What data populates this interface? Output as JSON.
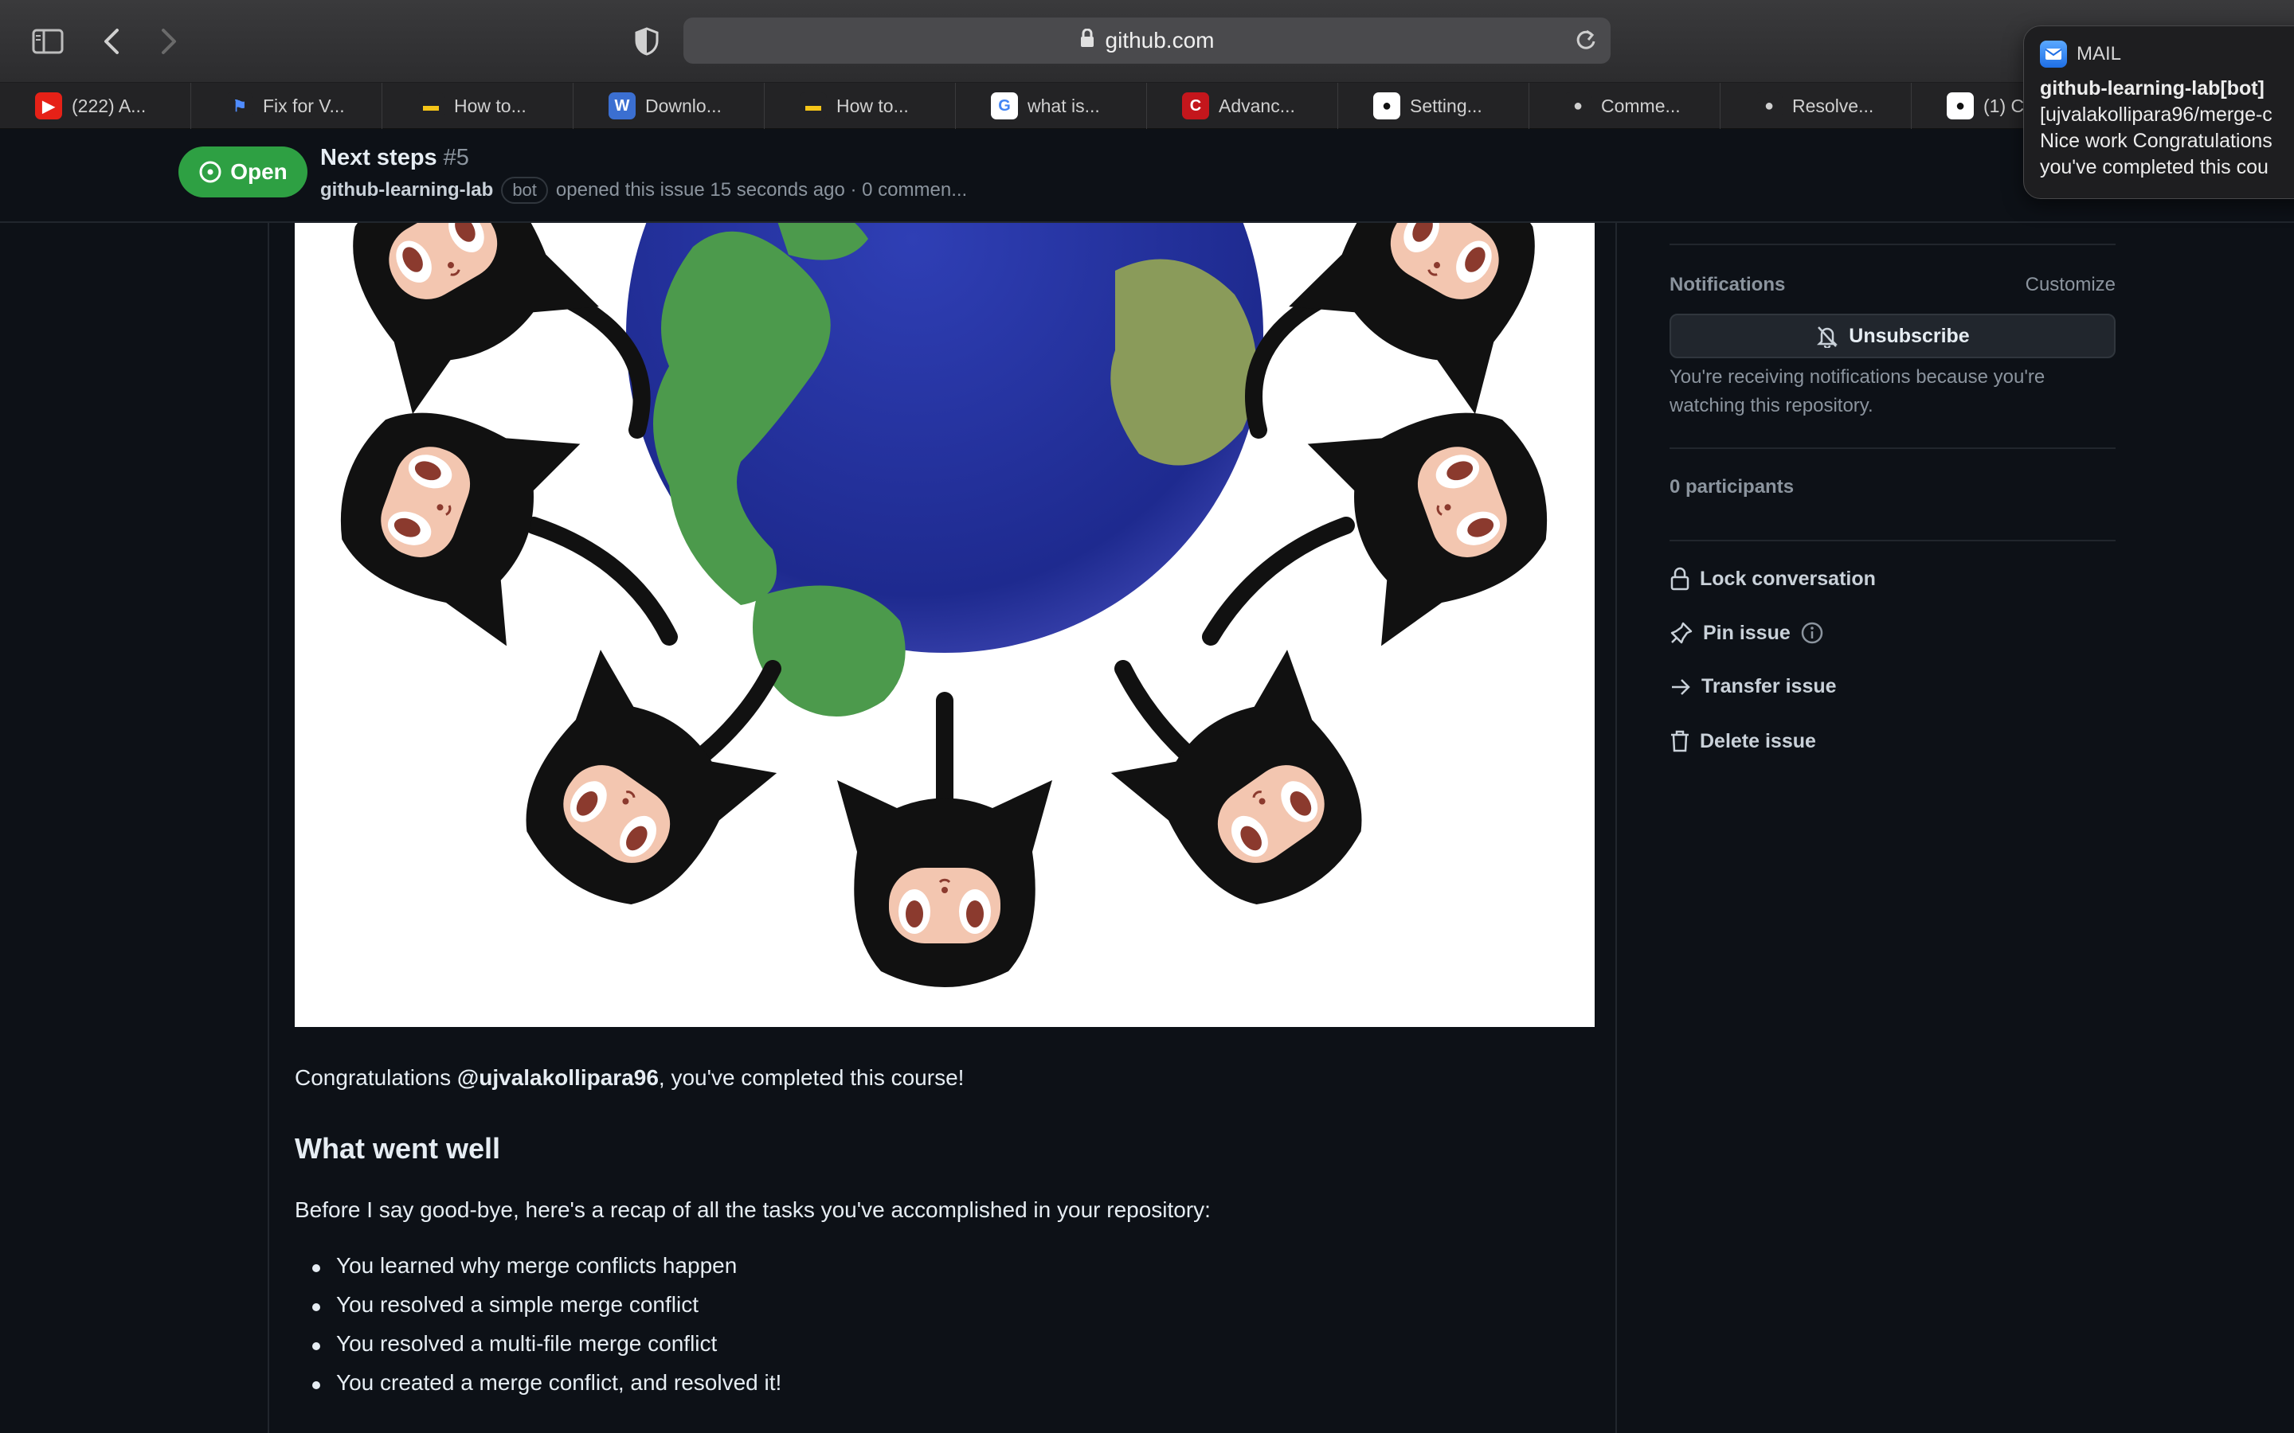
{
  "browser": {
    "url": "github.com",
    "tabs": [
      {
        "label": "(222) A...",
        "favicon": "youtube-icon",
        "fav_bg": "#e62117",
        "fav_fg": "#ffffff",
        "glyph": "▶"
      },
      {
        "label": "Fix for V...",
        "favicon": "bookmark-icon",
        "fav_bg": "#232325",
        "fav_fg": "#4f8cff",
        "glyph": "⚑"
      },
      {
        "label": "How to...",
        "favicon": "site-icon",
        "fav_bg": "#232325",
        "fav_fg": "#f5c518",
        "glyph": "▬"
      },
      {
        "label": "Downlo...",
        "favicon": "download-site-icon",
        "fav_bg": "#3b6fd1",
        "fav_fg": "#ffffff",
        "glyph": "W"
      },
      {
        "label": "How to...",
        "favicon": "site-icon",
        "fav_bg": "#232325",
        "fav_fg": "#f5c518",
        "glyph": "▬"
      },
      {
        "label": "what is...",
        "favicon": "google-icon",
        "fav_bg": "#ffffff",
        "fav_fg": "#4285f4",
        "glyph": "G"
      },
      {
        "label": "Advanc...",
        "favicon": "c-site-icon",
        "fav_bg": "#c4161c",
        "fav_fg": "#ffffff",
        "glyph": "C"
      },
      {
        "label": "Setting...",
        "favicon": "github-icon",
        "fav_bg": "#ffffff",
        "fav_fg": "#111111",
        "glyph": "●"
      },
      {
        "label": "Comme...",
        "favicon": "octocat-icon",
        "fav_bg": "#232325",
        "fav_fg": "#cfcfcf",
        "glyph": "●"
      },
      {
        "label": "Resolve...",
        "favicon": "octocat-icon",
        "fav_bg": "#232325",
        "fav_fg": "#cfcfcf",
        "glyph": "●"
      },
      {
        "label": "(1) C",
        "favicon": "github-icon",
        "fav_bg": "#ffffff",
        "fav_fg": "#111111",
        "glyph": "●"
      }
    ]
  },
  "notification_popup": {
    "app": "MAIL",
    "title": "github-learning-lab[bot]",
    "line1": "[ujvalakollipara96/merge-c",
    "line2": "Nice work Congratulations",
    "line3": "you've completed this cou"
  },
  "issue": {
    "state": "Open",
    "title": "Next steps",
    "number": "#5",
    "author": "github-learning-lab",
    "badge": "bot",
    "meta": "opened this issue 15 seconds ago · 0 commen..."
  },
  "body": {
    "congrats_prefix": "Congratulations ",
    "mention": "@ujvalakollipara96",
    "congrats_suffix": ", you've completed this course!",
    "heading": "What went well",
    "recap": "Before I say good-bye, here's a recap of all the tasks you've accomplished in your repository:",
    "tasks": [
      "You learned why merge conflicts happen",
      "You resolved a simple merge conflict",
      "You resolved a multi-file merge conflict",
      "You created a merge conflict, and resolved it!"
    ]
  },
  "sidebar": {
    "notifications_label": "Notifications",
    "customize": "Customize",
    "unsubscribe": "Unsubscribe",
    "note": "You're receiving notifications because you're watching this repository.",
    "participants": "0 participants",
    "actions": {
      "lock": "Lock conversation",
      "pin": "Pin issue",
      "transfer": "Transfer issue",
      "delete": "Delete issue"
    }
  },
  "colors": {
    "open_green": "#2ea043",
    "page_bg": "#0d1117"
  }
}
